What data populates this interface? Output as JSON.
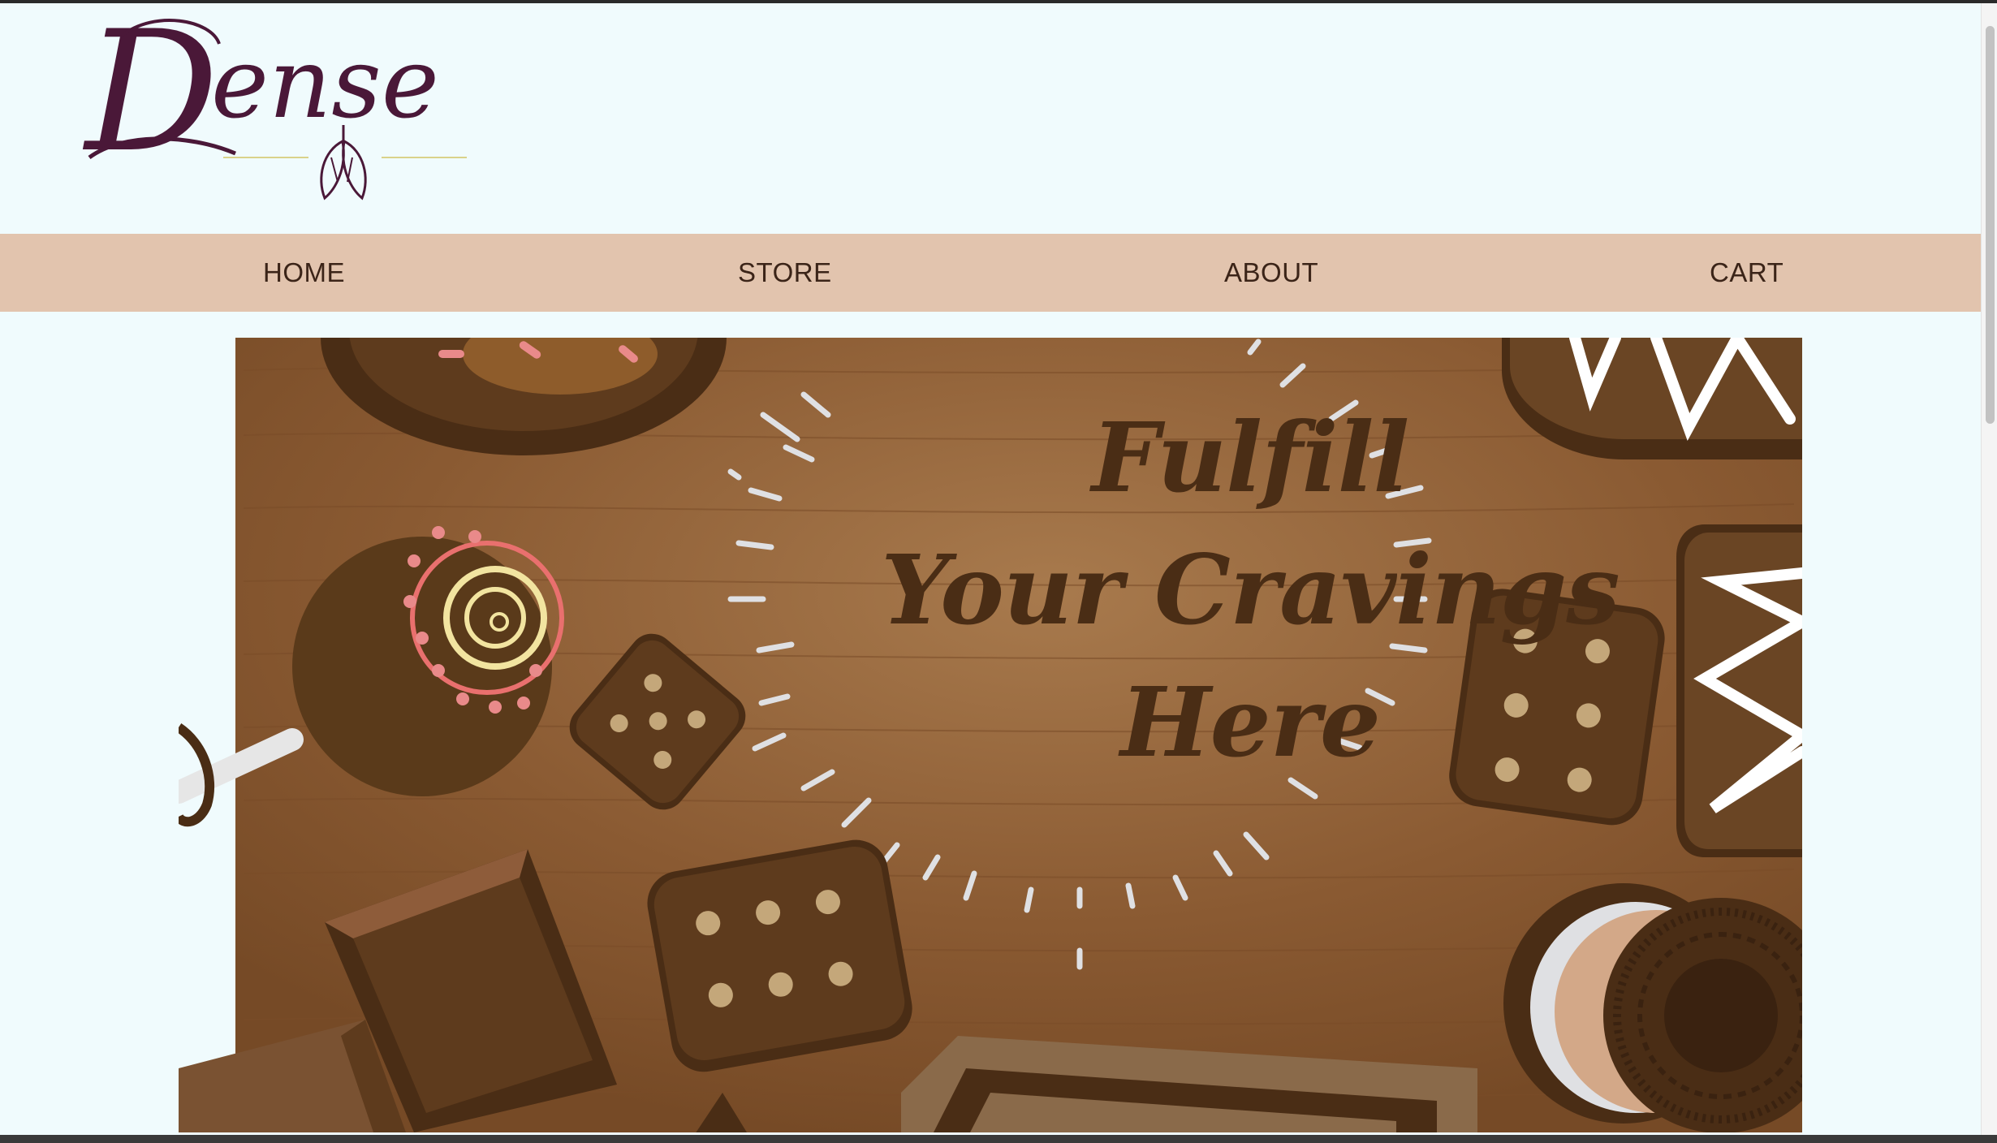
{
  "brand": {
    "name": "Dense"
  },
  "nav": {
    "home": "HOME",
    "store": "STORE",
    "about": "ABOUT",
    "cart": "CART"
  },
  "hero": {
    "line1": "Fulfill",
    "line2": "Your Cravings",
    "line3": "Here"
  },
  "colors": {
    "page_bg": "#f0fbfd",
    "nav_bg": "#e2c4ae",
    "nav_text": "#3b2418",
    "logo": "#4a1838",
    "wood": "#8a5a32",
    "chocolate": "#4a2d15"
  },
  "icons": [
    "cacao-pod-icon"
  ]
}
